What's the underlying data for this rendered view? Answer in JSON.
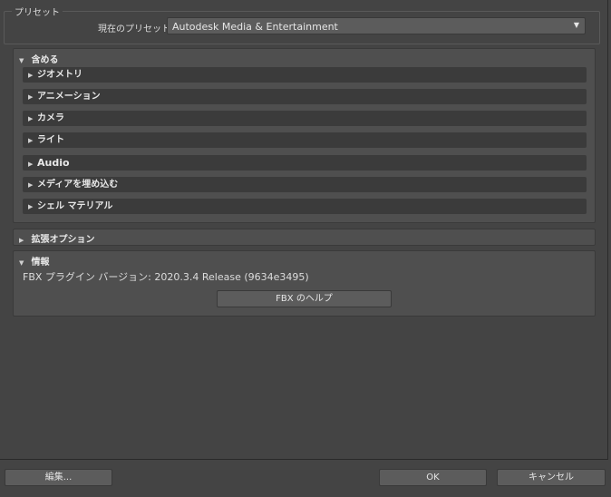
{
  "preset_group": {
    "title": "プリセット",
    "current_label": "現在のプリセット:",
    "current_value": "Autodesk Media & Entertainment"
  },
  "include": {
    "title": "含める",
    "items": [
      {
        "label": "ジオメトリ"
      },
      {
        "label": "アニメーション"
      },
      {
        "label": "カメラ"
      },
      {
        "label": "ライト"
      },
      {
        "label": "Audio"
      },
      {
        "label": "メディアを埋め込む"
      },
      {
        "label": "シェル マテリアル"
      }
    ]
  },
  "advanced": {
    "title": "拡張オプション"
  },
  "info": {
    "title": "情報",
    "version_text": "FBX プラグイン バージョン: 2020.3.4 Release (9634e3495)",
    "help_button": "FBX のヘルプ"
  },
  "footer": {
    "edit_button": "編集...",
    "ok_button": "OK",
    "cancel_button": "キャンセル"
  },
  "icons": {
    "expanded": "▼",
    "collapsed": "▶",
    "dropdown": "▼"
  }
}
